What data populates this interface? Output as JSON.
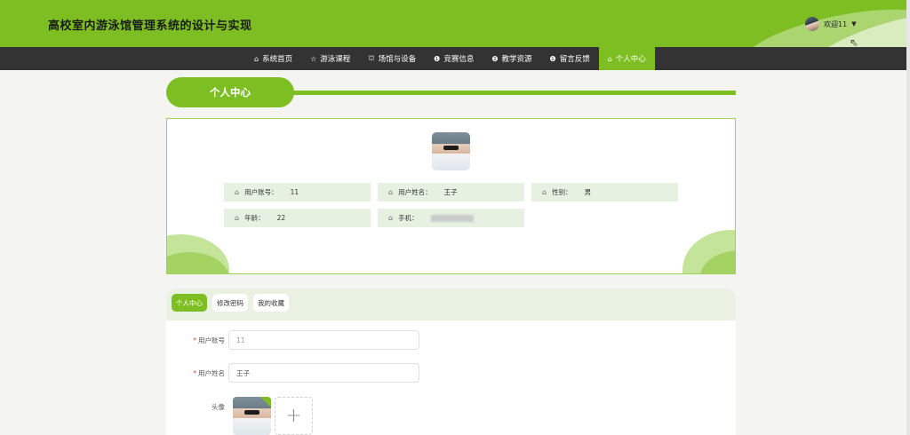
{
  "header": {
    "title": "高校室内游泳馆管理系统的设计与实现",
    "welcome": "欢迎11",
    "caret": "▼"
  },
  "nav": {
    "items": [
      {
        "icon": "⌂",
        "label": "系统首页"
      },
      {
        "icon": "☆",
        "label": "游泳课程"
      },
      {
        "icon": "⛫",
        "label": "场馆与设备"
      },
      {
        "icon": "❶",
        "label": "竞赛信息"
      },
      {
        "icon": "❷",
        "label": "教学资源"
      },
      {
        "icon": "❶",
        "label": "留言反馈"
      },
      {
        "icon": "⌂",
        "label": "个人中心"
      }
    ],
    "active_index": 6
  },
  "section": {
    "title": "个人中心"
  },
  "profile": {
    "fields": [
      {
        "label": "用户账号：",
        "value": "11"
      },
      {
        "label": "用户姓名：",
        "value": "王子"
      },
      {
        "label": "性别：",
        "value": "男"
      },
      {
        "label": "年龄：",
        "value": "22"
      },
      {
        "label": "手机：",
        "value": ""
      }
    ]
  },
  "tabs": [
    "个人中心",
    "修改密码",
    "我的收藏"
  ],
  "form": {
    "account_label": "用户账号",
    "account_value": "11",
    "name_label": "用户姓名",
    "name_value": "王子",
    "avatar_label": "头像",
    "add_symbol": "+"
  },
  "colors": {
    "accent": "#7dbf22",
    "nav_bg": "#333333",
    "info_bg": "#e7f1e2"
  }
}
